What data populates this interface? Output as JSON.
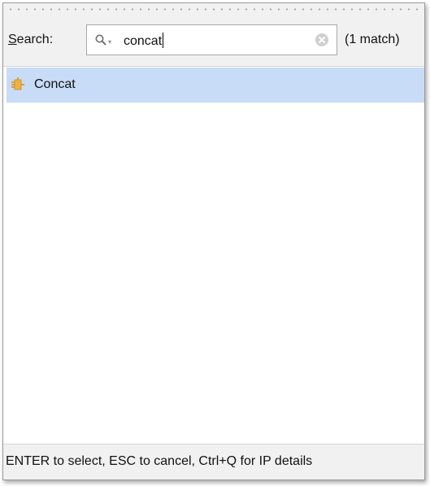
{
  "search": {
    "label_mnemonic": "S",
    "label_rest": "earch:",
    "value": "concat",
    "match_count": "(1 match)"
  },
  "results": [
    {
      "label": "Concat",
      "icon": "ip-block-icon",
      "selected": true
    }
  ],
  "footer": {
    "hint": "ENTER to select, ESC to cancel, Ctrl+Q for IP details"
  },
  "colors": {
    "selection": "#c8dcf7",
    "panel": "#f1f1f1",
    "ip_icon": "#f2b13b"
  }
}
